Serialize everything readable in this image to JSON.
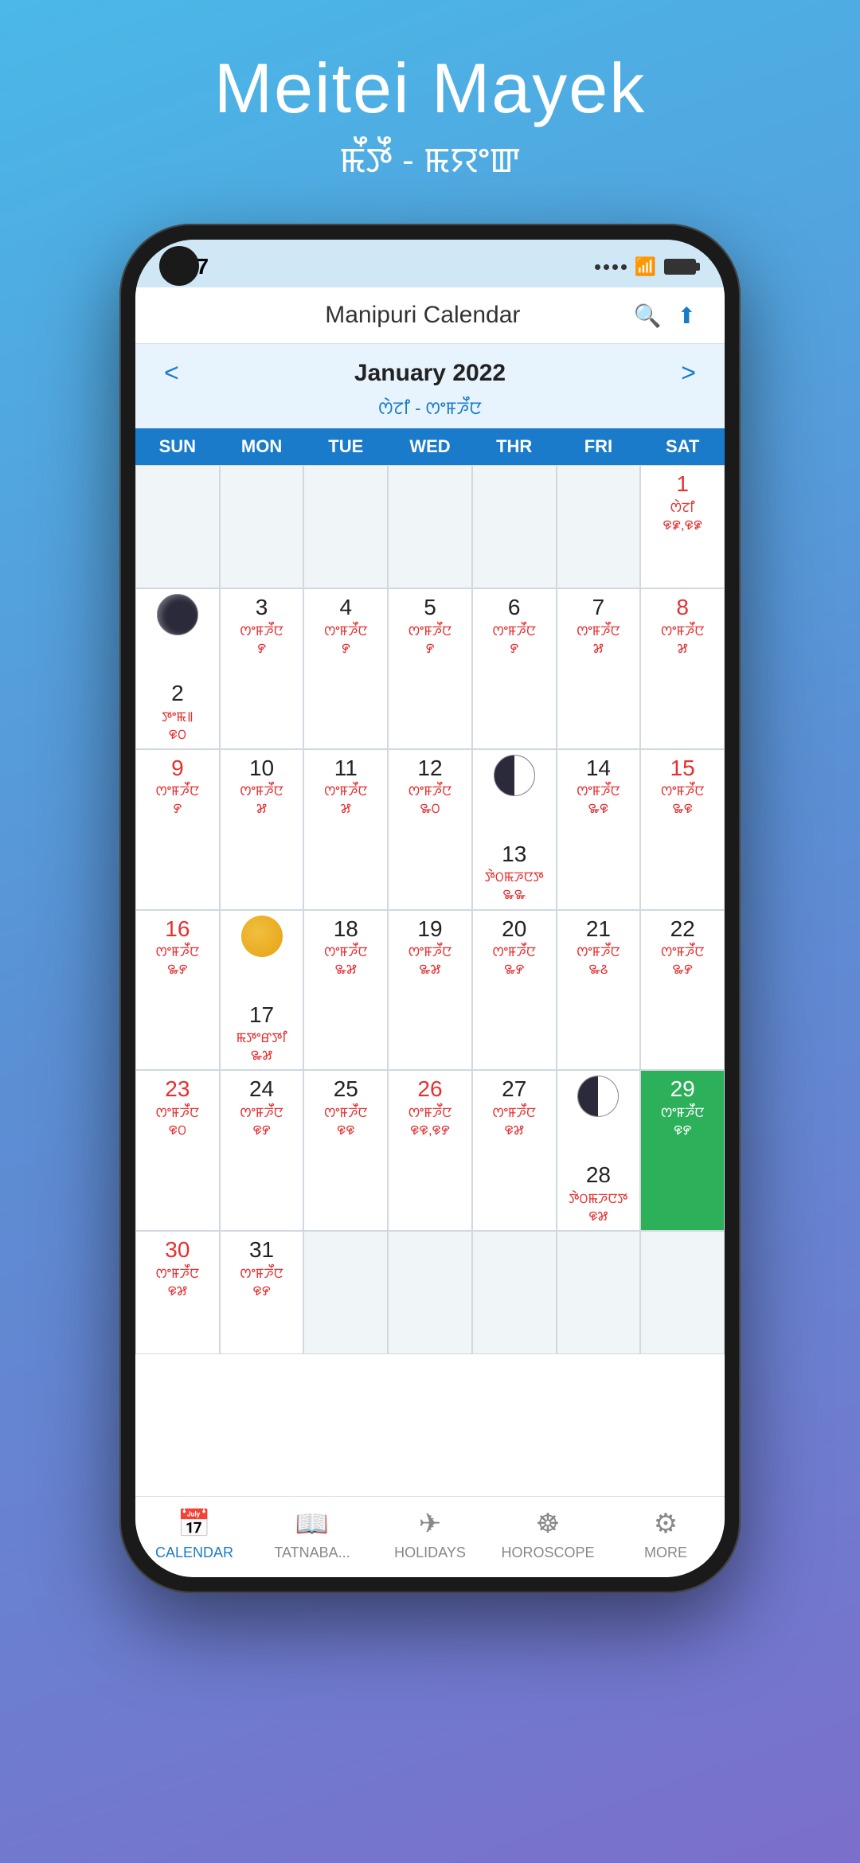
{
  "page": {
    "bg_title": "Meitei Mayek",
    "bg_subtitle": "ꯃꯩꯇꯩ - ꯃꯌꯦꯛ"
  },
  "status_bar": {
    "time": "9:47",
    "signal": ".....",
    "wifi": "wifi",
    "battery": "battery"
  },
  "navbar": {
    "title": "Manipuri Calendar",
    "search_label": "search",
    "share_label": "share"
  },
  "month_nav": {
    "title": "January 2022",
    "subtitle": "ꯁꯥꯖꯤ - ꯁꯦꯝꯍꯩꯅ",
    "prev": "<",
    "next": ">"
  },
  "day_headers": [
    "SUN",
    "MON",
    "TUE",
    "WED",
    "THR",
    "FRI",
    "SAT"
  ],
  "weeks": [
    [
      {
        "num": "",
        "meitei": "",
        "empty": true
      },
      {
        "num": "",
        "meitei": "",
        "empty": true
      },
      {
        "num": "",
        "meitei": "",
        "empty": true
      },
      {
        "num": "",
        "meitei": "",
        "empty": true
      },
      {
        "num": "",
        "meitei": "",
        "empty": true
      },
      {
        "num": "",
        "meitei": "",
        "empty": true
      },
      {
        "num": "1",
        "meitei": "ꯁꯥꯖꯤ\n꯶꯹,꯶꯹",
        "red": true
      }
    ],
    [
      {
        "num": "2",
        "meitei": "ꯇꯦꯃ꯫\n꯶꯰",
        "moon": "new"
      },
      {
        "num": "3",
        "meitei": "ꯁꯦꯝꯍꯩꯅ\n꯸"
      },
      {
        "num": "4",
        "meitei": "ꯁꯦꯝꯍꯩꯅ\n꯸"
      },
      {
        "num": "5",
        "meitei": "ꯁꯦꯝꯍꯩꯅ\n꯸"
      },
      {
        "num": "6",
        "meitei": "ꯁꯦꯝꯍꯩꯅ\n꯸"
      },
      {
        "num": "7",
        "meitei": "ꯁꯦꯝꯍꯩꯅ\n꯷"
      },
      {
        "num": "8",
        "meitei": "ꯁꯦꯝꯍꯩꯅ\n꯷",
        "red": true
      }
    ],
    [
      {
        "num": "9",
        "meitei": "ꯁꯦꯝꯍꯩꯅ\n꯸",
        "red": true
      },
      {
        "num": "10",
        "meitei": "ꯁꯦꯝꯍꯩꯅ\n꯷"
      },
      {
        "num": "11",
        "meitei": "ꯁꯦꯝꯍꯩꯅ\n꯷"
      },
      {
        "num": "12",
        "meitei": "ꯁꯦꯝꯍꯩꯅ\n꯳꯰"
      },
      {
        "num": "13",
        "meitei": "ꯇꯥ꯰ꯃꯍꯅꯇ\n꯳꯳",
        "moon": "first_q"
      },
      {
        "num": "14",
        "meitei": "ꯁꯦꯝꯍꯩꯅ\n꯳꯶"
      },
      {
        "num": "15",
        "meitei": "ꯁꯦꯝꯍꯩꯅ\n꯳꯶",
        "red": true
      }
    ],
    [
      {
        "num": "16",
        "meitei": "ꯁꯦꯝꯍꯩꯅ\n꯳꯸",
        "red": true
      },
      {
        "num": "17",
        "meitei": "ꯃꯇꯦꯔꯇꯤ\n꯳꯷",
        "moon": "full"
      },
      {
        "num": "18",
        "meitei": "ꯁꯦꯝꯍꯩꯅ\n꯳꯷"
      },
      {
        "num": "19",
        "meitei": "ꯁꯦꯝꯍꯩꯅ\n꯳꯷"
      },
      {
        "num": "20",
        "meitei": "ꯁꯦꯝꯍꯩꯅ\n꯳꯸"
      },
      {
        "num": "21",
        "meitei": "ꯁꯦꯝꯍꯩꯅ\n꯳꯴"
      },
      {
        "num": "22",
        "meitei": "ꯁꯦꯝꯍꯩꯅ\n꯳꯸"
      }
    ],
    [
      {
        "num": "23",
        "meitei": "ꯁꯦꯝꯍꯩꯅ\n꯶꯰",
        "red": true
      },
      {
        "num": "24",
        "meitei": "ꯁꯦꯝꯍꯩꯅ\n꯶꯸"
      },
      {
        "num": "25",
        "meitei": "ꯁꯦꯝꯍꯩꯅ\n꯶꯶"
      },
      {
        "num": "26",
        "meitei": "ꯁꯦꯝꯍꯩꯅ\n꯶꯶,꯶꯸",
        "red": true
      },
      {
        "num": "27",
        "meitei": "ꯁꯦꯝꯍꯩꯅ\n꯶꯷"
      },
      {
        "num": "28",
        "meitei": "ꯇꯥ꯰ꯃꯍꯅꯇ\n꯶꯷",
        "moon": "last_q"
      },
      {
        "num": "29",
        "meitei": "ꯁꯦꯝꯍꯩꯅ\n꯶꯸",
        "today": true
      }
    ],
    [
      {
        "num": "30",
        "meitei": "ꯁꯦꯝꯍꯩꯅ\n꯶꯷",
        "red": true
      },
      {
        "num": "31",
        "meitei": "ꯁꯦꯝꯍꯩꯅ\n꯶꯸"
      },
      {
        "num": "",
        "meitei": "",
        "empty": true
      },
      {
        "num": "",
        "meitei": "",
        "empty": true
      },
      {
        "num": "",
        "meitei": "",
        "empty": true
      },
      {
        "num": "",
        "meitei": "",
        "empty": true
      },
      {
        "num": "",
        "meitei": "",
        "empty": true
      }
    ]
  ],
  "tabs": [
    {
      "label": "CALENDAR",
      "icon": "📅",
      "active": true
    },
    {
      "label": "TATNABA...",
      "icon": "📖",
      "active": false
    },
    {
      "label": "HOLIDAYS",
      "icon": "✈",
      "active": false
    },
    {
      "label": "HOROSCOPE",
      "icon": "☸",
      "active": false
    },
    {
      "label": "MORE",
      "icon": "⚙",
      "active": false
    }
  ]
}
